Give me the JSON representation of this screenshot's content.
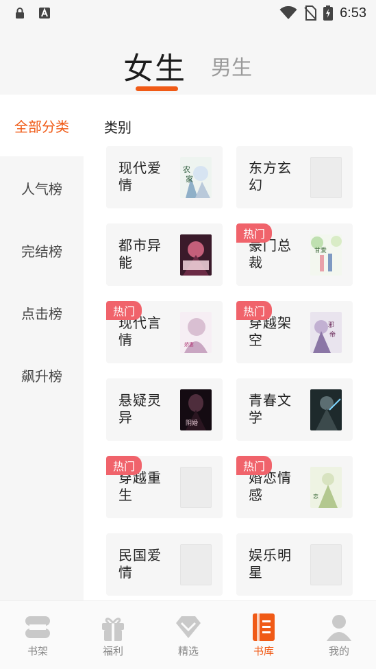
{
  "status_bar": {
    "time": "6:53",
    "icons": [
      "lock-icon",
      "a-box-icon",
      "wifi-icon",
      "no-sim-icon",
      "battery-charging-icon"
    ]
  },
  "gender_tabs": {
    "female": "女生",
    "male": "男生",
    "selected": "female",
    "accent": "#f05a16"
  },
  "sidebar": {
    "items": [
      {
        "label": "全部分类",
        "active": true
      },
      {
        "label": "人气榜",
        "active": false
      },
      {
        "label": "完结榜",
        "active": false
      },
      {
        "label": "点击榜",
        "active": false
      },
      {
        "label": "飙升榜",
        "active": false
      }
    ]
  },
  "main": {
    "section_title": "类别",
    "hot_label": "热门",
    "categories": [
      {
        "label": "现代爱情",
        "hot": false,
        "cover": "cover-art"
      },
      {
        "label": "东方玄幻",
        "hot": false,
        "cover": "blank"
      },
      {
        "label": "都市异能",
        "hot": false,
        "cover": "cover-art"
      },
      {
        "label": "豪门总裁",
        "hot": true,
        "cover": "cover-art"
      },
      {
        "label": "现代言情",
        "hot": true,
        "cover": "cover-art"
      },
      {
        "label": "穿越架空",
        "hot": true,
        "cover": "cover-art"
      },
      {
        "label": "悬疑灵异",
        "hot": false,
        "cover": "cover-art"
      },
      {
        "label": "青春文学",
        "hot": false,
        "cover": "cover-art"
      },
      {
        "label": "穿越重生",
        "hot": true,
        "cover": "blank"
      },
      {
        "label": "婚恋情感",
        "hot": true,
        "cover": "cover-art"
      },
      {
        "label": "民国爱情",
        "hot": false,
        "cover": "blank"
      },
      {
        "label": "娱乐明星",
        "hot": false,
        "cover": "blank"
      }
    ]
  },
  "bottom_nav": {
    "items": [
      {
        "label": "书架",
        "icon": "bookshelf-icon",
        "active": false
      },
      {
        "label": "福利",
        "icon": "gift-icon",
        "active": false
      },
      {
        "label": "精选",
        "icon": "diamond-icon",
        "active": false
      },
      {
        "label": "书库",
        "icon": "library-icon",
        "active": true
      },
      {
        "label": "我的",
        "icon": "user-icon",
        "active": false
      }
    ]
  }
}
